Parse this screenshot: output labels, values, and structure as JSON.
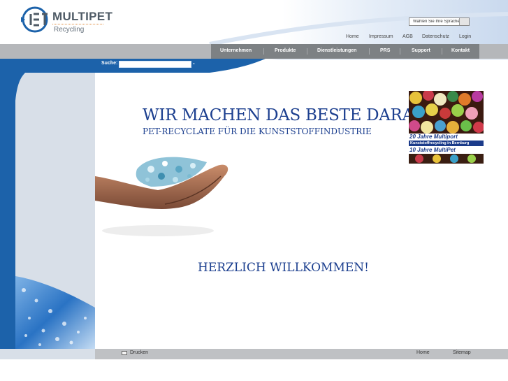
{
  "logo": {
    "title": "MULTIPET",
    "subtitle": "Recycling",
    "icon": "pet-recycling-logo-icon"
  },
  "language_selector": {
    "selected": "Wählen Sie Ihre Sprache"
  },
  "top_links": [
    "Home",
    "Impressum",
    "AGB",
    "Datenschutz",
    "Login"
  ],
  "nav": {
    "items": [
      "Unternehmen",
      "Produkte",
      "Dienstleistungen",
      "PRS",
      "Support",
      "Kontakt"
    ]
  },
  "search": {
    "label": "Suche:",
    "value": "",
    "go": "-"
  },
  "main": {
    "headline": "WIR MACHEN DAS BESTE DARAUS.",
    "subline": "PET-RECYCLATE FÜR DIE KUNSTSTOFFINDUSTRIE",
    "welcome": "HERZLICH WILLKOMMEN!"
  },
  "anniversary": {
    "line1": "20 Jahre Multiport",
    "line2": "Kunststoffrecycling in Bernburg",
    "line3": "10 Jahre MultiPet"
  },
  "footer": {
    "print": "Drucken",
    "home": "Home",
    "sitemap": "Sitemap"
  },
  "colors": {
    "brand_blue": "#1c62aa",
    "text_blue": "#1c3f8f",
    "nav_gray": "#7d8184",
    "logo_gray": "#4f5b66"
  }
}
